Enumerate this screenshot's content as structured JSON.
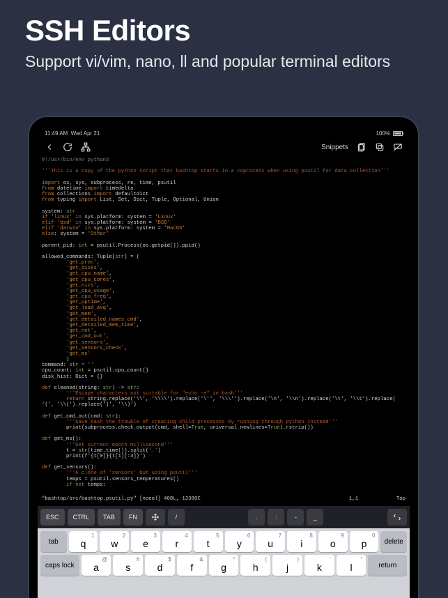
{
  "promo": {
    "title": "SSH Editors",
    "subtitle": "Support vi/vim, nano, ll and popular terminal editors"
  },
  "statusbar": {
    "time": "11:49 AM",
    "date": "Wed Apr 21",
    "battery_pct": "100%"
  },
  "toolbar": {
    "snippets_label": "Snippets"
  },
  "code": {
    "shebang": "#!/usr/bin/env python3",
    "module_docstring": "'''This is a copy of the python script that bashtop starts in a coprocess when using psutil for data collection'''",
    "import1_kw": "import",
    "import1_mods": "os, sys, subprocess, re, time, psutil",
    "import2_from": "from",
    "import2_mod": "datetime",
    "import2_imp": "import",
    "import2_names": "timedelta",
    "import3_from": "from",
    "import3_mod": "collections",
    "import3_imp": "import",
    "import3_names": "defaultdict",
    "import4_from": "from",
    "import4_mod": "typing",
    "import4_imp": "import",
    "import4_names": "List, Set, Dict, Tuple, Optional, Union",
    "system_decl": "system: ",
    "system_type": "str",
    "if_kw": "if",
    "linux_str": "'linux'",
    "in_kw": "in",
    "sys_platform": "sys.platform: system = ",
    "linux_val": "'Linux'",
    "elif_kw": "elif",
    "bsd_str": "'bsd'",
    "bsd_val": "'BSD'",
    "elif2_kw": "elif",
    "darwin_str": "'darwin'",
    "macos_val": "'MacOS'",
    "else_kw": "else",
    "else_body": ": system = ",
    "other_str": "'Other'",
    "parent_pid_line": "parent_pid: ",
    "int_type": "int",
    "parent_pid_rhs": " = psutil.Process(os.getpid()).ppid()",
    "allowed_lhs": "allowed_commands: Tuple[",
    "str_type": "str",
    "allowed_rhs": "] = (",
    "cmds": [
      "'get_proc'",
      "'get_disks'",
      "'get_cpu_name'",
      "'get_cpu_cores'",
      "'get_nics'",
      "'get_cpu_usage'",
      "'get_cpu_freq'",
      "'get_uptime'",
      "'get_load_avg'",
      "'get_mem'",
      "'get_detailed_names_cmd'",
      "'get_detailed_mem_time'",
      "'get_net'",
      "'get_cmd_out'",
      "'get_sensors'",
      "'get_sensors_check'",
      "'get_ms'"
    ],
    "command_line": "command: ",
    "command_rhs": " = ''",
    "cpu_count_line": "cpu_count: ",
    "cpu_count_rhs": " = psutil.cpu_count()",
    "disk_hist_line": "disk_hist: Dict = {}",
    "def_kw": "def",
    "cleaned_sig": " cleaned(string: ",
    "cleaned_sig2": ") -> ",
    "cleaned_sig3": ":",
    "cleaned_doc": "'''Escape characters not suitable for \"echo -e\" in bash'''",
    "return_kw": "return",
    "cleaned_ret": " string.replace('\\\\', '\\\\\\\\').replace('\\'', '\\\\\\'').replace('\\n', '\\\\n').replace('\\t', '\\\\t').replace(",
    "cleaned_ret2": "'(', '\\\\(').replace(')', '\\\\)')",
    "getcmd_sig": " get_cmd_out(cmd: ",
    "getcmd_sig2": "):",
    "getcmd_doc": "'''Save bash the trouble of creating child processes by running through python instead'''",
    "print_fn": "print",
    "getcmd_body": "(subprocess.check_output(cmd, shell=",
    "true_kw": "True",
    "getcmd_body2": ", universal_newlines=",
    "getcmd_body3": ").rstrip())",
    "getms_sig": " get_ms():",
    "getms_doc": "'''Get current epoch millisecond'''",
    "getms_l1a": "        t = ",
    "getms_l1b": "(time.time()).split(",
    "getms_dot": "'.'",
    "getms_l1c": ")",
    "getms_l2": "        print(f'{t[0]}{t[1][:3]}')",
    "getsens_sig": " get_sensors():",
    "getsens_doc": "'''A clone of 'sensors' but using psutil'''",
    "getsens_l1": "        temps = psutil.sensors_temperatures()",
    "getsens_l2a": "        ",
    "not_kw": "not",
    "getsens_l2b": " temps:"
  },
  "vim": {
    "file": "\"bashtop/src/bashtop.psutil.py\" [noeol] 408L, 13380C",
    "pos": "1,1",
    "scroll": "Top"
  },
  "extra_keys": {
    "esc": "ESC",
    "ctrl": "CTRL",
    "tab": "TAB",
    "fn": "FN",
    "slash": "/",
    "dot": ".",
    "colon": ":",
    "dash": "-",
    "under": "_"
  },
  "keyboard": {
    "row1_alts": [
      "1",
      "2",
      "3",
      "4",
      "5",
      "6",
      "7",
      "8",
      "9",
      "0"
    ],
    "row1": [
      "q",
      "w",
      "e",
      "r",
      "t",
      "y",
      "u",
      "i",
      "o",
      "p"
    ],
    "tab": "tab",
    "delete": "delete",
    "row2_alts": [
      "@",
      "#",
      "$",
      "&",
      "*",
      "(",
      ")",
      "'",
      "\""
    ],
    "row2": [
      "a",
      "s",
      "d",
      "f",
      "g",
      "h",
      "j",
      "k",
      "l"
    ],
    "caps": "caps lock",
    "return": "return"
  }
}
